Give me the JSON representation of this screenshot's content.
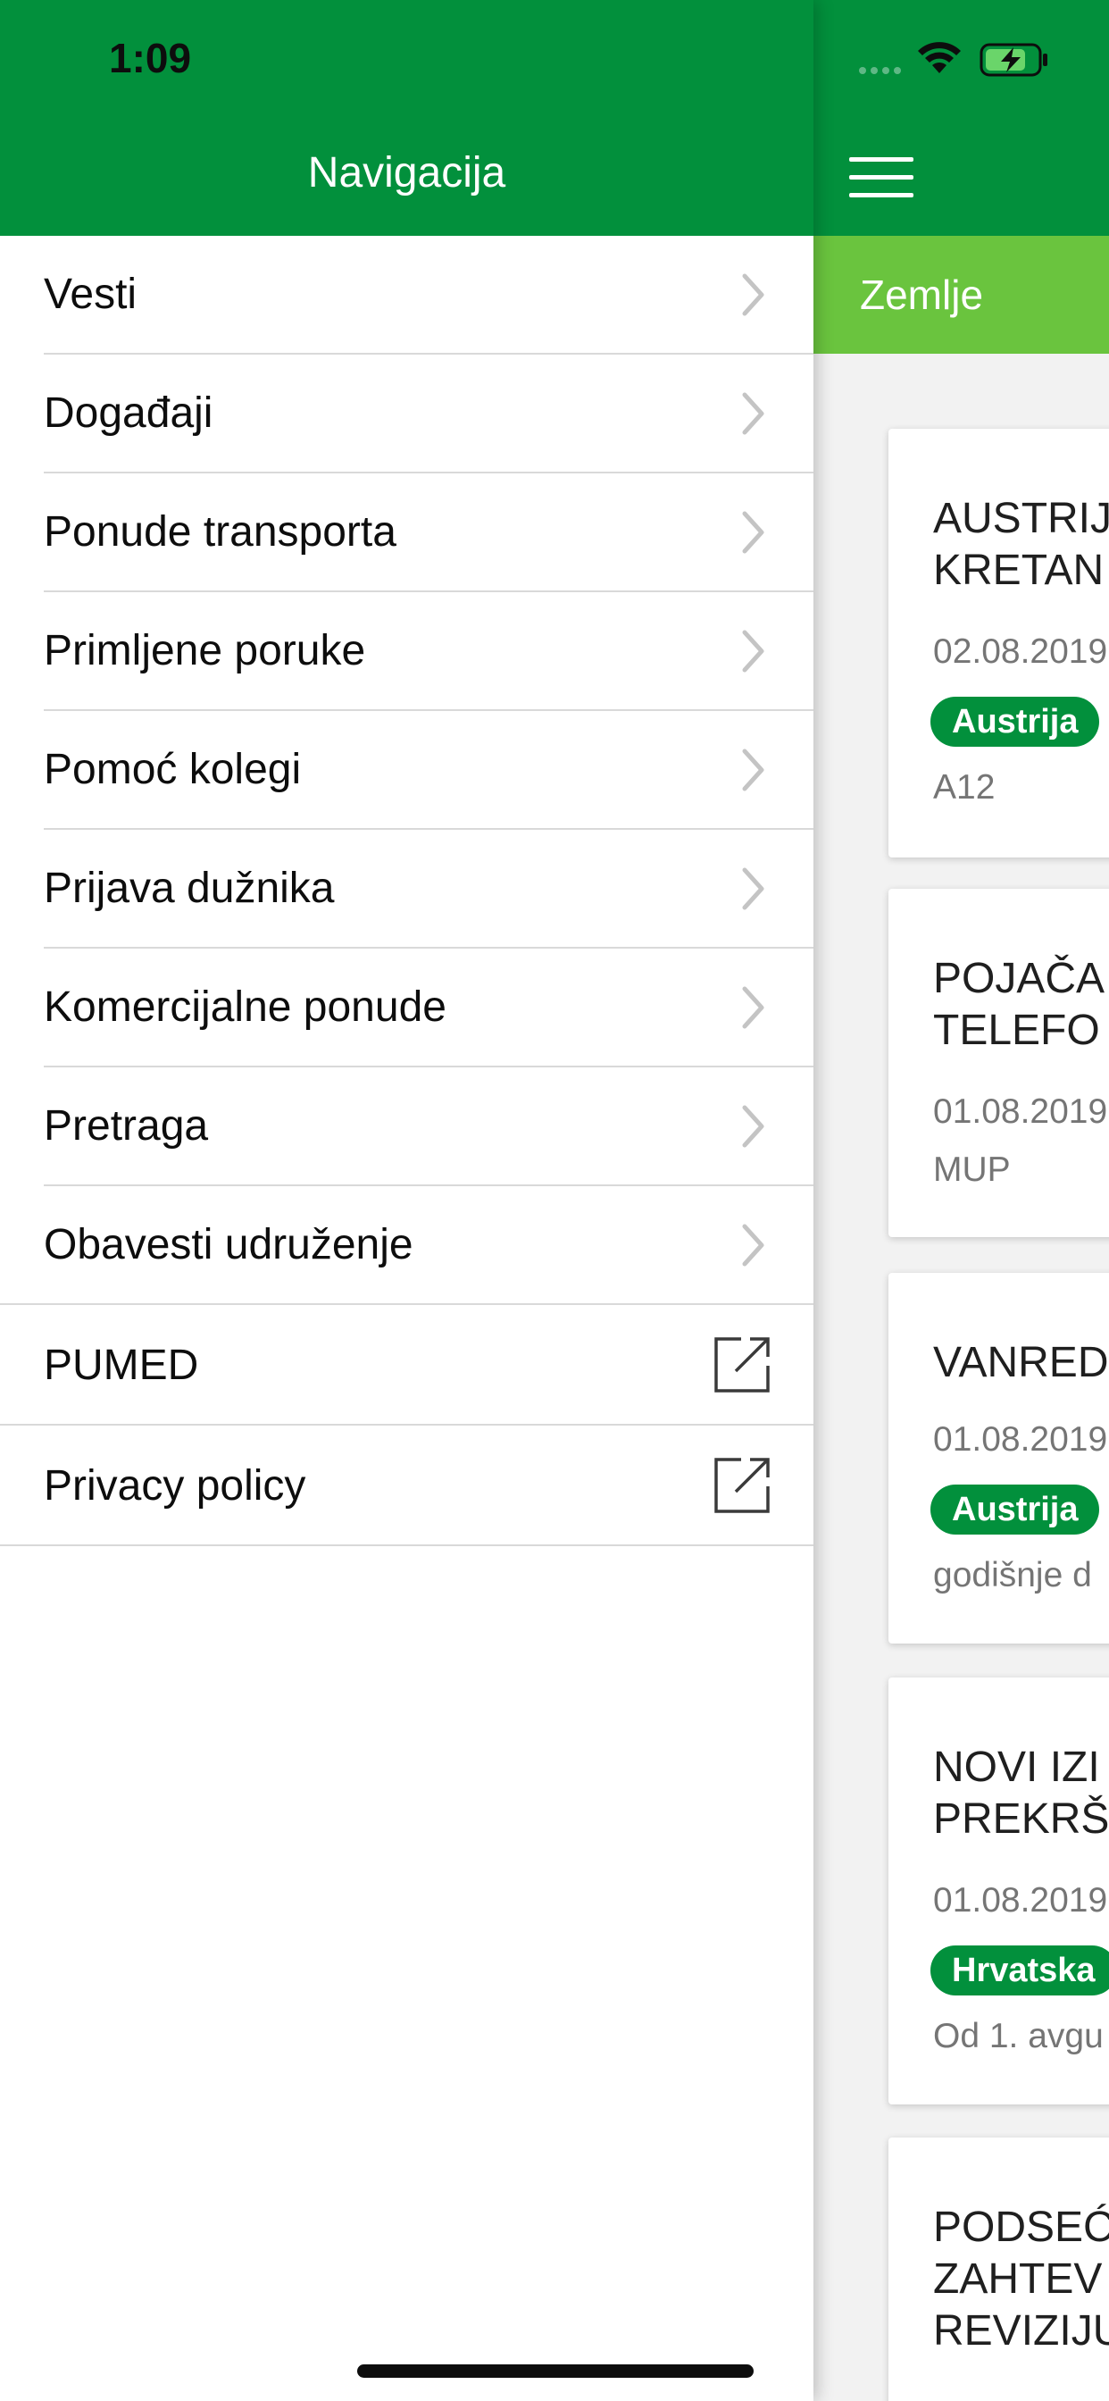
{
  "status_bar": {
    "time": "1:09"
  },
  "drawer": {
    "title": "Navigacija",
    "items": [
      {
        "label": "Vesti",
        "icon": "chevron-right-icon"
      },
      {
        "label": "Događaji",
        "icon": "chevron-right-icon"
      },
      {
        "label": "Ponude transporta",
        "icon": "chevron-right-icon"
      },
      {
        "label": "Primljene poruke",
        "icon": "chevron-right-icon"
      },
      {
        "label": "Pomoć kolegi",
        "icon": "chevron-right-icon"
      },
      {
        "label": "Prijava dužnika",
        "icon": "chevron-right-icon"
      },
      {
        "label": "Komercijalne ponude",
        "icon": "chevron-right-icon"
      },
      {
        "label": "Pretraga",
        "icon": "chevron-right-icon"
      },
      {
        "label": "Obavesti udruženje",
        "icon": "chevron-right-icon"
      },
      {
        "label": "PUMED",
        "icon": "external-link-icon"
      },
      {
        "label": "Privacy policy",
        "icon": "external-link-icon"
      }
    ]
  },
  "content": {
    "tab_label": "Zemlje",
    "cards": [
      {
        "title_line1": "AUSTRIJ",
        "title_line2": "KRETAN",
        "date": "02.08.2019",
        "tag": "Austrija",
        "subtitle": "A12"
      },
      {
        "title_line1": "POJAČA",
        "title_line2": "TELEFO",
        "date": "01.08.2019",
        "tag": "",
        "subtitle": "MUP"
      },
      {
        "title_line1": "VANRED",
        "title_line2": "",
        "date": "01.08.2019",
        "tag": "Austrija",
        "subtitle": "godišnje d"
      },
      {
        "title_line1": "NOVI IZI",
        "title_line2": "PREKRŠ",
        "date": "01.08.2019",
        "tag": "Hrvatska",
        "subtitle": "Od 1. avgu"
      },
      {
        "title_line1": "PODSEĆ",
        "title_line2": "ZAHTEV",
        "title_line3": "REVIZIJU"
      }
    ]
  },
  "colors": {
    "primary_green": "#02903c",
    "tab_green": "#6ac43e",
    "text_dark": "#0d0d0d",
    "text_muted": "#757575"
  }
}
